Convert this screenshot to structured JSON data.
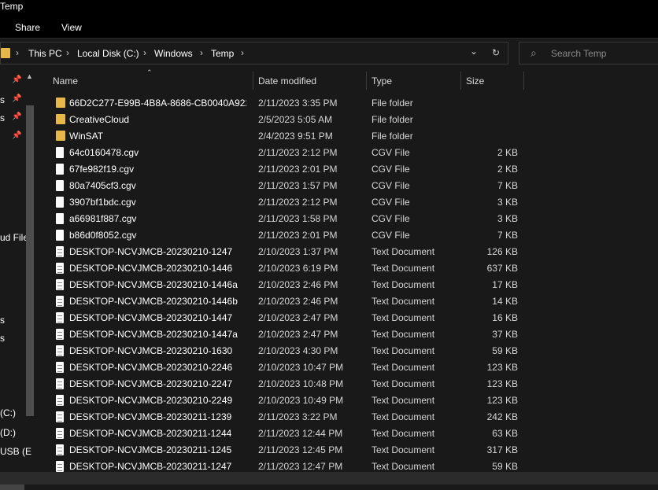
{
  "window": {
    "title": "Temp"
  },
  "ribbon": {
    "tabs": [
      "Share",
      "View"
    ]
  },
  "address": {
    "crumbs": [
      "This PC",
      "Local Disk (C:)",
      "Windows",
      "Temp"
    ],
    "chevron_glyph": "⌄",
    "refresh_glyph": "↻"
  },
  "search": {
    "placeholder": "Search Temp",
    "icon_glyph": "⌕"
  },
  "nav": {
    "labels": [
      "s",
      "s",
      "ud File",
      "s",
      "s",
      "(C:)",
      "(D:)",
      "USB (E"
    ],
    "pin_glyph": "📌"
  },
  "columns": {
    "name": "Name",
    "date": "Date modified",
    "type": "Type",
    "size": "Size"
  },
  "files": [
    {
      "icon": "folder",
      "name": "66D2C277-E99B-4B8A-8686-CB0040A922...",
      "date": "2/11/2023 3:35 PM",
      "type": "File folder",
      "size": ""
    },
    {
      "icon": "folder",
      "name": "CreativeCloud",
      "date": "2/5/2023 5:05 AM",
      "type": "File folder",
      "size": ""
    },
    {
      "icon": "folder",
      "name": "WinSAT",
      "date": "2/4/2023 9:51 PM",
      "type": "File folder",
      "size": ""
    },
    {
      "icon": "file",
      "name": "64c0160478.cgv",
      "date": "2/11/2023 2:12 PM",
      "type": "CGV File",
      "size": "2 KB"
    },
    {
      "icon": "file",
      "name": "67fe982f19.cgv",
      "date": "2/11/2023 2:01 PM",
      "type": "CGV File",
      "size": "2 KB"
    },
    {
      "icon": "file",
      "name": "80a7405cf3.cgv",
      "date": "2/11/2023 1:57 PM",
      "type": "CGV File",
      "size": "7 KB"
    },
    {
      "icon": "file",
      "name": "3907bf1bdc.cgv",
      "date": "2/11/2023 2:12 PM",
      "type": "CGV File",
      "size": "3 KB"
    },
    {
      "icon": "file",
      "name": "a66981f887.cgv",
      "date": "2/11/2023 1:58 PM",
      "type": "CGV File",
      "size": "3 KB"
    },
    {
      "icon": "file",
      "name": "b86d0f8052.cgv",
      "date": "2/11/2023 2:01 PM",
      "type": "CGV File",
      "size": "7 KB"
    },
    {
      "icon": "doc",
      "name": "DESKTOP-NCVJMCB-20230210-1247",
      "date": "2/10/2023 1:37 PM",
      "type": "Text Document",
      "size": "126 KB"
    },
    {
      "icon": "doc",
      "name": "DESKTOP-NCVJMCB-20230210-1446",
      "date": "2/10/2023 6:19 PM",
      "type": "Text Document",
      "size": "637 KB"
    },
    {
      "icon": "doc",
      "name": "DESKTOP-NCVJMCB-20230210-1446a",
      "date": "2/10/2023 2:46 PM",
      "type": "Text Document",
      "size": "17 KB"
    },
    {
      "icon": "doc",
      "name": "DESKTOP-NCVJMCB-20230210-1446b",
      "date": "2/10/2023 2:46 PM",
      "type": "Text Document",
      "size": "14 KB"
    },
    {
      "icon": "doc",
      "name": "DESKTOP-NCVJMCB-20230210-1447",
      "date": "2/10/2023 2:47 PM",
      "type": "Text Document",
      "size": "16 KB"
    },
    {
      "icon": "doc",
      "name": "DESKTOP-NCVJMCB-20230210-1447a",
      "date": "2/10/2023 2:47 PM",
      "type": "Text Document",
      "size": "37 KB"
    },
    {
      "icon": "doc",
      "name": "DESKTOP-NCVJMCB-20230210-1630",
      "date": "2/10/2023 4:30 PM",
      "type": "Text Document",
      "size": "59 KB"
    },
    {
      "icon": "doc",
      "name": "DESKTOP-NCVJMCB-20230210-2246",
      "date": "2/10/2023 10:47 PM",
      "type": "Text Document",
      "size": "123 KB"
    },
    {
      "icon": "doc",
      "name": "DESKTOP-NCVJMCB-20230210-2247",
      "date": "2/10/2023 10:48 PM",
      "type": "Text Document",
      "size": "123 KB"
    },
    {
      "icon": "doc",
      "name": "DESKTOP-NCVJMCB-20230210-2249",
      "date": "2/10/2023 10:49 PM",
      "type": "Text Document",
      "size": "123 KB"
    },
    {
      "icon": "doc",
      "name": "DESKTOP-NCVJMCB-20230211-1239",
      "date": "2/11/2023 3:22 PM",
      "type": "Text Document",
      "size": "242 KB"
    },
    {
      "icon": "doc",
      "name": "DESKTOP-NCVJMCB-20230211-1244",
      "date": "2/11/2023 12:44 PM",
      "type": "Text Document",
      "size": "63 KB"
    },
    {
      "icon": "doc",
      "name": "DESKTOP-NCVJMCB-20230211-1245",
      "date": "2/11/2023 12:45 PM",
      "type": "Text Document",
      "size": "317 KB"
    },
    {
      "icon": "doc",
      "name": "DESKTOP-NCVJMCB-20230211-1247",
      "date": "2/11/2023 12:47 PM",
      "type": "Text Document",
      "size": "59 KB"
    }
  ]
}
